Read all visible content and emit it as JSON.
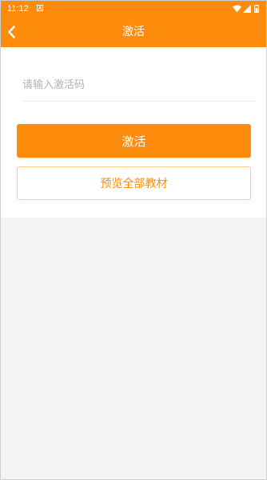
{
  "status_bar": {
    "time": "11:12",
    "icons": [
      "a-notification-icon",
      "wifi-icon",
      "signal-icon",
      "battery-icon"
    ]
  },
  "header": {
    "title": "激活",
    "back_icon": "chevron-left-icon"
  },
  "form": {
    "code_placeholder": "请输入激活码",
    "code_value": "",
    "activate_label": "激活",
    "preview_label": "预览全部教材"
  },
  "colors": {
    "accent": "#fd8c0c",
    "background": "#f4f4f4",
    "card": "#ffffff",
    "placeholder": "#b2b2b2",
    "preview_border": "#fdcc8e"
  }
}
